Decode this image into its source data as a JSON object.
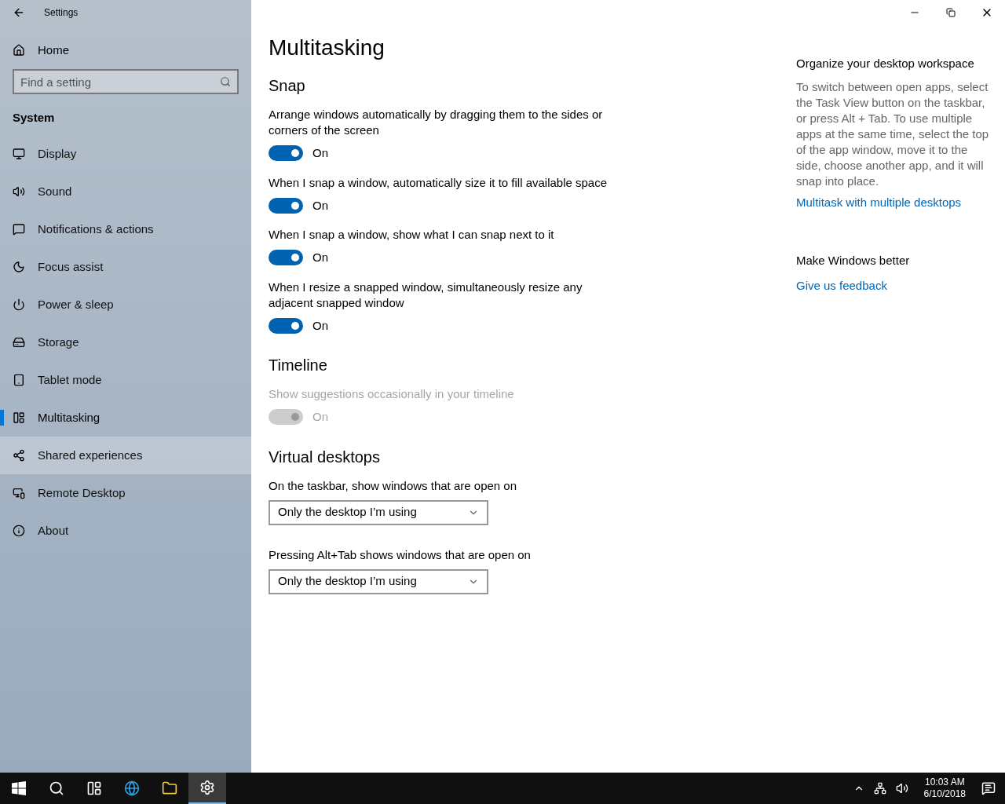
{
  "window": {
    "title": "Settings"
  },
  "sidebar": {
    "home": "Home",
    "search": {
      "placeholder": "Find a setting"
    },
    "group": "System",
    "items": [
      {
        "label": "Display",
        "selected": false,
        "hovered": false
      },
      {
        "label": "Sound",
        "selected": false,
        "hovered": false
      },
      {
        "label": "Notifications & actions",
        "selected": false,
        "hovered": false
      },
      {
        "label": "Focus assist",
        "selected": false,
        "hovered": false
      },
      {
        "label": "Power & sleep",
        "selected": false,
        "hovered": false
      },
      {
        "label": "Storage",
        "selected": false,
        "hovered": false
      },
      {
        "label": "Tablet mode",
        "selected": false,
        "hovered": false
      },
      {
        "label": "Multitasking",
        "selected": true,
        "hovered": false
      },
      {
        "label": "Shared experiences",
        "selected": false,
        "hovered": true
      },
      {
        "label": "Remote Desktop",
        "selected": false,
        "hovered": false
      },
      {
        "label": "About",
        "selected": false,
        "hovered": false
      }
    ]
  },
  "page": {
    "title": "Multitasking",
    "sections": [
      {
        "heading": "Snap",
        "settings": [
          {
            "kind": "toggle",
            "label": "Arrange windows automatically by dragging them to the sides or corners of the screen",
            "on": true,
            "disabled": false,
            "state_text": "On"
          },
          {
            "kind": "toggle",
            "label": "When I snap a window, automatically size it to fill available space",
            "on": true,
            "disabled": false,
            "state_text": "On"
          },
          {
            "kind": "toggle",
            "label": "When I snap a window, show what I can snap next to it",
            "on": true,
            "disabled": false,
            "state_text": "On"
          },
          {
            "kind": "toggle",
            "label": "When I resize a snapped window, simultaneously resize any adjacent snapped window",
            "on": true,
            "disabled": false,
            "state_text": "On"
          }
        ]
      },
      {
        "heading": "Timeline",
        "settings": [
          {
            "kind": "toggle",
            "label": "Show suggestions occasionally in your timeline",
            "on": true,
            "disabled": true,
            "state_text": "On"
          }
        ]
      },
      {
        "heading": "Virtual desktops",
        "settings": [
          {
            "kind": "dropdown",
            "label": "On the taskbar, show windows that are open on",
            "value": "Only the desktop I’m using"
          },
          {
            "kind": "dropdown",
            "label": "Pressing Alt+Tab shows windows that are open on",
            "value": "Only the desktop I’m using"
          }
        ]
      }
    ]
  },
  "aside": [
    {
      "heading": "Organize your desktop workspace",
      "text": "To switch between open apps, select the Task View button on the taskbar, or press Alt + Tab. To use multiple apps at the same time, select the top of the app window, move it to the side, choose another app, and it will snap into place.",
      "link": "Multitask with multiple desktops"
    },
    {
      "heading": "Make Windows better",
      "link": "Give us feedback"
    }
  ],
  "taskbar": {
    "apps": [
      {
        "selected": false
      },
      {
        "selected": false
      },
      {
        "selected": false
      },
      {
        "selected": false
      },
      {
        "selected": false
      },
      {
        "selected": true
      }
    ],
    "time": "10:03 AM",
    "date": "6/10/2018"
  }
}
